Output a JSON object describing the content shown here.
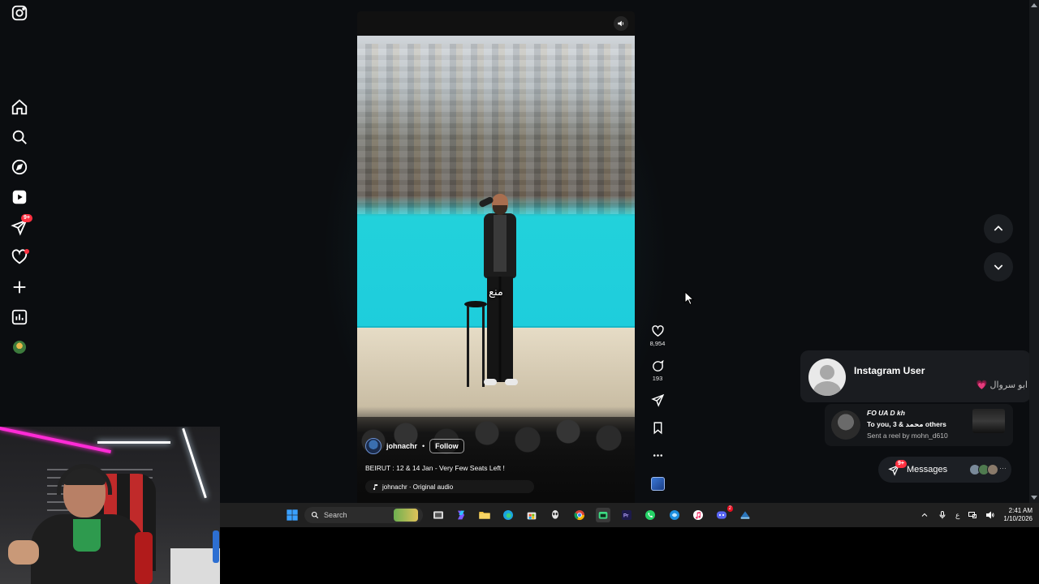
{
  "app": {
    "name": "Instagram"
  },
  "sidebar": {
    "items": [
      {
        "id": "instagram",
        "icon": "instagram-logo-icon"
      },
      {
        "id": "home",
        "icon": "home-icon"
      },
      {
        "id": "search",
        "icon": "search-icon"
      },
      {
        "id": "explore",
        "icon": "compass-icon"
      },
      {
        "id": "reels",
        "icon": "reels-icon"
      },
      {
        "id": "messages",
        "icon": "send-icon",
        "badge": "9+"
      },
      {
        "id": "notifications",
        "icon": "heart-icon",
        "dot": true
      },
      {
        "id": "create",
        "icon": "plus-icon"
      },
      {
        "id": "dashboard",
        "icon": "chart-icon"
      },
      {
        "id": "profile",
        "icon": "avatar-icon"
      }
    ]
  },
  "reel": {
    "subtitle": "منع",
    "author": "johnachr",
    "follow_label": "Follow",
    "separator": "•",
    "caption": "BEIRUT : 12 & 14 Jan - Very Few Seats Left !",
    "audio": "johnachr · Original audio",
    "likes": "8,954",
    "comments": "193"
  },
  "notification": {
    "title": "Instagram User",
    "subtitle": "ابو سروال",
    "emoji": "💗"
  },
  "reel_message": {
    "name": "FO UA D kh",
    "line2": "To you, 3 & محمد others",
    "line3": "Sent a reel by mohn_d610"
  },
  "messages_pill": {
    "label": "Messages",
    "badge": "9+",
    "more": "···"
  },
  "taskbar": {
    "search_placeholder": "Search",
    "tray_lang": "ع",
    "time": "2:41 AM",
    "date": "1/10/2026",
    "discord_badge": "2"
  },
  "colors": {
    "background": "#0b0d10",
    "accent_red": "#ff3040",
    "stage_cyan": "#18b7c8"
  }
}
